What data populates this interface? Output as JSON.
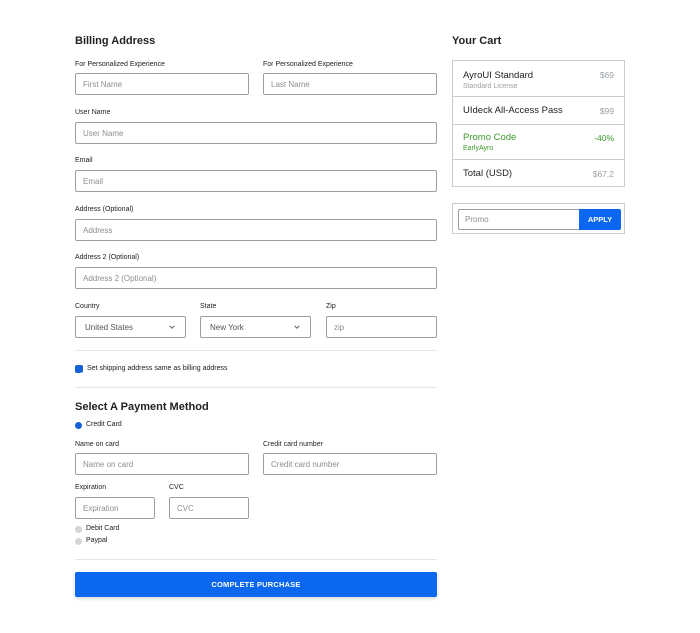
{
  "billing": {
    "title": "Billing Address",
    "first_name": {
      "label": "For Personalized Experience",
      "placeholder": "First Name"
    },
    "last_name": {
      "label": "For Personalized Experience",
      "placeholder": "Last Name"
    },
    "username": {
      "label": "User Name",
      "placeholder": "User Name"
    },
    "email": {
      "label": "Email",
      "placeholder": "Email"
    },
    "address": {
      "label": "Address (Optional)",
      "placeholder": "Address"
    },
    "address2": {
      "label": "Address 2 (Optional)",
      "placeholder": "Address 2 (Optional)"
    },
    "country": {
      "label": "Country",
      "value": "United States"
    },
    "state": {
      "label": "State",
      "value": "New York"
    },
    "zip": {
      "label": "Zip",
      "placeholder": "zip"
    },
    "same_shipping_label": "Set shipping address same as billing address",
    "same_shipping_checked": true
  },
  "payment": {
    "title": "Select A Payment Method",
    "methods": [
      {
        "label": "Credit Card",
        "selected": true
      },
      {
        "label": "Debit Card",
        "selected": false
      },
      {
        "label": "Paypal",
        "selected": false
      }
    ],
    "name_on_card": {
      "label": "Name on card",
      "placeholder": "Name on card"
    },
    "card_number": {
      "label": "Credit card number",
      "placeholder": "Credit card number"
    },
    "expiration": {
      "label": "Expiration",
      "placeholder": "Expiration"
    },
    "cvc": {
      "label": "CVC",
      "placeholder": "CVC"
    },
    "submit_label": "COMPLETE PURCHASE"
  },
  "cart": {
    "title": "Your Cart",
    "items": [
      {
        "name": "AyroUI Standard",
        "sub": "Standard License",
        "price": "$69"
      },
      {
        "name": "UIdeck All-Access Pass",
        "sub": "",
        "price": "$99"
      },
      {
        "name": "Promo Code",
        "sub": "EarlyAyro",
        "price": "-40%"
      },
      {
        "name": "Total (USD)",
        "sub": "",
        "price": "$67.2"
      }
    ],
    "promo_placeholder": "Promo",
    "apply_label": "APPLY"
  },
  "colors": {
    "primary": "#0b66f0",
    "promo_green": "#3a9a2a",
    "muted": "#9aa0a6"
  }
}
